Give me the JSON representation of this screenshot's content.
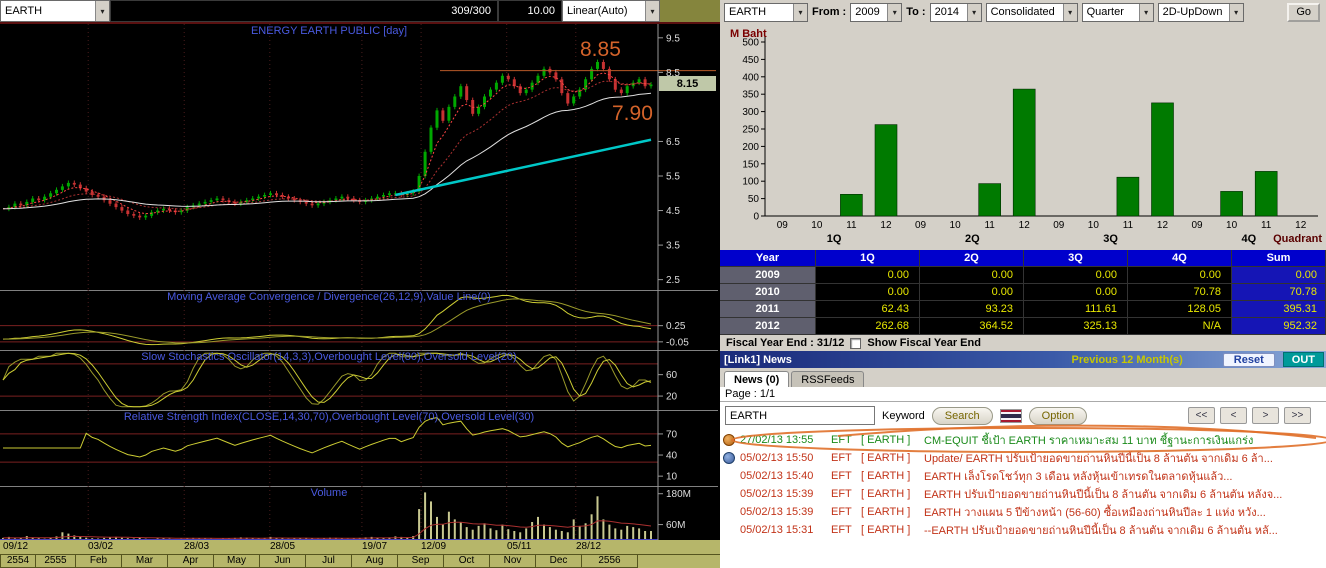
{
  "left": {
    "toolbar": {
      "symbol": "EARTH",
      "range": "309/300",
      "price": "10.00",
      "scale": "Linear(Auto)"
    }
  },
  "right": {
    "toolbar": {
      "symbol": "EARTH",
      "from_label": "From :",
      "from": "2009",
      "to_label": "To :",
      "to": "2014",
      "statement": "Consolidated",
      "period": "Quarter",
      "display": "2D-UpDown",
      "go": "Go"
    },
    "table": {
      "headers": [
        "Year",
        "1Q",
        "2Q",
        "3Q",
        "4Q",
        "Sum"
      ],
      "rows": [
        {
          "year": "2009",
          "q": [
            "0.00",
            "0.00",
            "0.00",
            "0.00"
          ],
          "sum": "0.00"
        },
        {
          "year": "2010",
          "q": [
            "0.00",
            "0.00",
            "0.00",
            "70.78"
          ],
          "sum": "70.78"
        },
        {
          "year": "2011",
          "q": [
            "62.43",
            "93.23",
            "111.61",
            "128.05"
          ],
          "sum": "395.31"
        },
        {
          "year": "2012",
          "q": [
            "262.68",
            "364.52",
            "325.13",
            "N/A"
          ],
          "sum": "952.32"
        }
      ]
    },
    "fiscal": {
      "label": "Fiscal Year End : 31/12",
      "show_label": "Show Fiscal Year End"
    },
    "news": {
      "bar_title": "[Link1] News",
      "previous": "Previous 12 Month(s)",
      "reset": "Reset",
      "out": "OUT",
      "tabs": [
        "News (0)",
        "RSSFeeds"
      ],
      "page": "Page : 1/1",
      "search_value": "EARTH",
      "keyword_label": "Keyword",
      "search": "Search",
      "option": "Option",
      "nav": [
        "<<",
        "<",
        ">",
        ">>"
      ],
      "items": [
        {
          "time": "27/02/13 13:55",
          "feed": "EFT",
          "sym": "[ EARTH ]",
          "text": "CM-EQUIT ชี้เป้า EARTH ราคาเหมาะสม 11 บาท ชี้ฐานะการเงินแกร่ง",
          "status": "green",
          "icon": "globe-orange"
        },
        {
          "time": "05/02/13 15:50",
          "feed": "EFT",
          "sym": "[ EARTH ]",
          "text": "Update/ EARTH ปรับเป้ายอดขายถ่านหินปีนี้เป็น 8 ล้านตัน จากเดิม 6 ล้า...",
          "status": "red",
          "icon": "globe-blue"
        },
        {
          "time": "05/02/13 15:40",
          "feed": "EFT",
          "sym": "[ EARTH ]",
          "text": "EARTH เล็งโรดโชว์ทุก 3 เดือน หลังหุ้นเข้าเทรดในตลาดหุ้นแล้ว...",
          "status": "red",
          "icon": ""
        },
        {
          "time": "05/02/13 15:39",
          "feed": "EFT",
          "sym": "[ EARTH ]",
          "text": "EARTH ปรับเป้ายอดขายถ่านหินปีนี้เป็น 8 ล้านตัน จากเดิม 6 ล้านตัน หลังจ...",
          "status": "red",
          "icon": ""
        },
        {
          "time": "05/02/13 15:39",
          "feed": "EFT",
          "sym": "[ EARTH ]",
          "text": "EARTH วางแผน 5 ปีข้างหน้า (56-60) ซื้อเหมืองถ่านหินปีละ 1 แห่ง หวัง...",
          "status": "red",
          "icon": ""
        },
        {
          "time": "05/02/13 15:31",
          "feed": "EFT",
          "sym": "[ EARTH ]",
          "text": "--EARTH ปรับเป้ายอดขายถ่านหินปีนี้เป็น 8 ล้านตัน จากเดิม 6 ล้านตัน หลั...",
          "status": "red",
          "icon": ""
        }
      ]
    }
  },
  "chart_data": [
    {
      "type": "candlestick",
      "title": "ENERGY EARTH PUBLIC [day]",
      "symbol": "EARTH",
      "ylim": [
        2.2,
        9.9
      ],
      "yticks": [
        9.5,
        8.5,
        6.5,
        5.5,
        4.5,
        3.5,
        2.5
      ],
      "last_price": "8.15",
      "annotations": [
        {
          "text": "8.85",
          "y": 8.85
        },
        {
          "text": "7.90",
          "y": 7.9
        }
      ],
      "close": [
        4.55,
        4.6,
        4.7,
        4.65,
        4.75,
        4.85,
        4.8,
        4.9,
        5.0,
        5.1,
        5.2,
        5.3,
        5.25,
        5.15,
        5.05,
        4.95,
        4.9,
        4.8,
        4.7,
        4.6,
        4.5,
        4.4,
        4.35,
        4.3,
        4.35,
        4.45,
        4.5,
        4.55,
        4.5,
        4.45,
        4.5,
        4.6,
        4.65,
        4.7,
        4.75,
        4.8,
        4.85,
        4.8,
        4.75,
        4.7,
        4.75,
        4.8,
        4.85,
        4.9,
        4.95,
        5.0,
        4.95,
        4.9,
        4.85,
        4.8,
        4.75,
        4.7,
        4.65,
        4.7,
        4.75,
        4.8,
        4.85,
        4.9,
        4.85,
        4.8,
        4.75,
        4.8,
        4.85,
        4.9,
        4.95,
        5.0,
        5.0,
        4.95,
        5.0,
        5.05,
        5.5,
        6.2,
        6.9,
        7.4,
        7.1,
        7.5,
        7.8,
        8.1,
        7.7,
        7.3,
        7.5,
        7.8,
        8.0,
        8.2,
        8.4,
        8.3,
        8.1,
        7.9,
        8.0,
        8.2,
        8.4,
        8.6,
        8.5,
        8.3,
        7.9,
        7.6,
        7.8,
        8.0,
        8.3,
        8.6,
        8.8,
        8.6,
        8.3,
        8.0,
        7.9,
        8.1,
        8.2,
        8.3,
        8.1,
        8.15
      ],
      "volume_m": [
        8,
        12,
        6,
        9,
        15,
        10,
        7,
        5,
        9,
        14,
        30,
        25,
        18,
        12,
        9,
        7,
        6,
        8,
        10,
        12,
        9,
        7,
        6,
        8,
        5,
        4,
        6,
        7,
        5,
        4,
        5,
        6,
        8,
        7,
        6,
        5,
        4,
        6,
        7,
        8,
        10,
        9,
        7,
        6,
        8,
        12,
        9,
        7,
        5,
        6,
        7,
        8,
        6,
        5,
        7,
        9,
        8,
        6,
        5,
        7,
        8,
        10,
        12,
        9,
        8,
        10,
        14,
        12,
        10,
        15,
        120,
        185,
        150,
        90,
        60,
        110,
        80,
        70,
        50,
        40,
        55,
        65,
        45,
        38,
        60,
        42,
        35,
        30,
        45,
        70,
        90,
        60,
        50,
        40,
        35,
        30,
        80,
        55,
        65,
        100,
        170,
        80,
        60,
        45,
        40,
        55,
        50,
        45,
        35,
        35
      ],
      "indicators": {
        "macd": {
          "label": "Moving Average Convergence / Divergence(26,12,9),Value Line(0)",
          "yticks": [
            0.25,
            -0.05
          ]
        },
        "stochastics": {
          "label": "Slow Stochastics Oscillator(14,3,3),Overbought Level(80),Oversold Level(20)",
          "yticks": [
            60,
            20
          ],
          "levels": [
            80,
            20
          ]
        },
        "rsi": {
          "label": "Relative Strength Index(CLOSE,14,30,70),Overbought Level(70),Oversold Level(30)",
          "yticks": [
            70,
            40,
            10
          ],
          "levels": [
            70,
            30
          ]
        },
        "volume": {
          "label": "Volume",
          "yticks_m": [
            180,
            60
          ]
        }
      },
      "x_dates": [
        "09/12",
        "03/02",
        "28/03",
        "28/05",
        "19/07",
        "12/09",
        "05/11",
        "28/12"
      ],
      "x_months": [
        "2554",
        "2555",
        "Feb",
        "Mar",
        "Apr",
        "May",
        "Jun",
        "Jul",
        "Aug",
        "Sep",
        "Oct",
        "Nov",
        "Dec",
        "2556"
      ]
    },
    {
      "type": "bar",
      "ylabel": "M Baht",
      "corner_label": "Quadrant",
      "groups": [
        "1Q",
        "2Q",
        "3Q",
        "4Q"
      ],
      "years": [
        "09",
        "10",
        "11",
        "12"
      ],
      "series": {
        "1Q": [
          0,
          0,
          62.43,
          262.68
        ],
        "2Q": [
          0,
          0,
          93.23,
          364.52
        ],
        "3Q": [
          0,
          0,
          111.61,
          325.13
        ],
        "4Q": [
          0,
          70.78,
          128.05,
          null
        ]
      },
      "ylim": [
        0,
        500
      ],
      "yticks": [
        0,
        50,
        100,
        150,
        200,
        250,
        300,
        350,
        400,
        450,
        500
      ],
      "bar_color": "#007a00"
    }
  ]
}
